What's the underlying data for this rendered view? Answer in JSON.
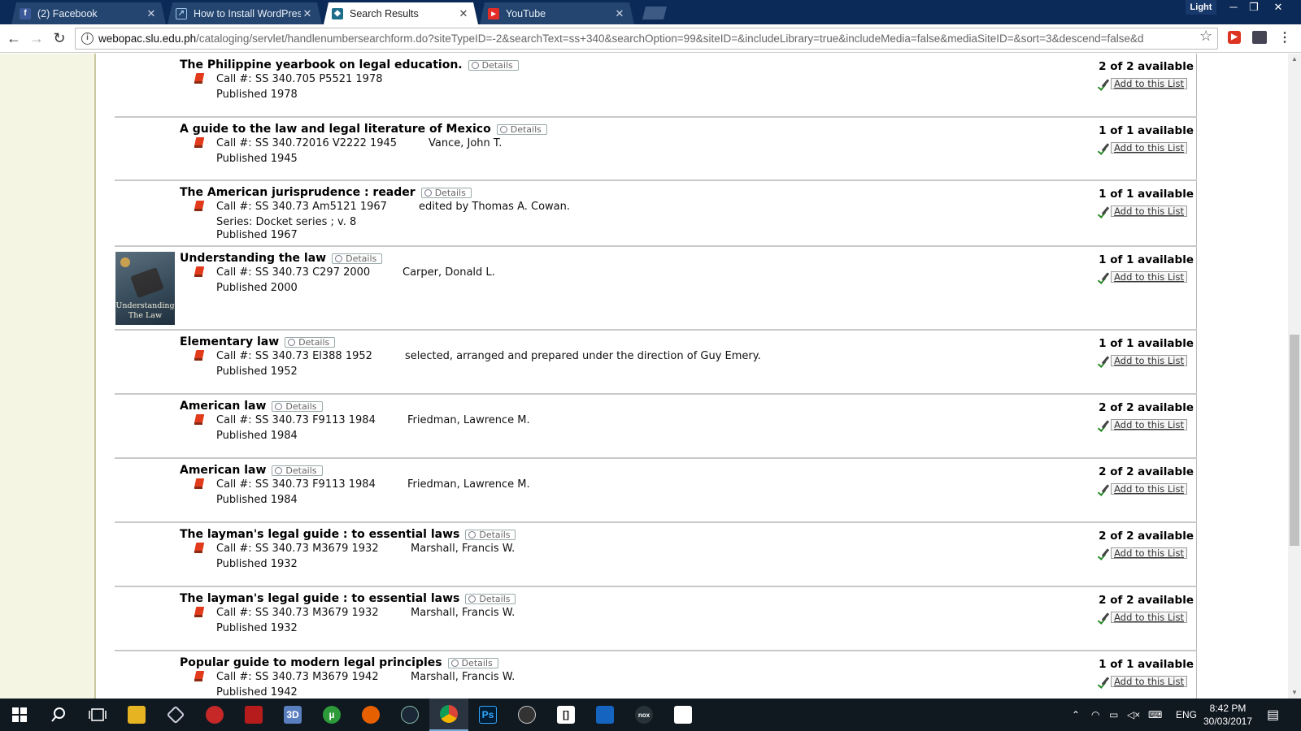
{
  "browser": {
    "tabs": [
      {
        "label": "(2) Facebook",
        "icon": "facebook-icon",
        "active": false
      },
      {
        "label": "How to Install WordPress",
        "icon": "wordpress-icon",
        "active": false
      },
      {
        "label": "Search Results",
        "icon": "site-icon",
        "active": true
      },
      {
        "label": "YouTube",
        "icon": "youtube-icon",
        "active": false
      }
    ],
    "profile_label": "Light",
    "url_host": "webopac.slu.edu.ph",
    "url_path": "/cataloging/servlet/handlenumbersearchform.do?siteTypeID=-2&searchText=ss+340&searchOption=99&siteID=&includeLibrary=true&includeMedia=false&mediaSiteID=&sort=3&descend=false&d"
  },
  "labels": {
    "details": "Details",
    "add_to_list": "Add to this List",
    "call_prefix": "Call #:",
    "published_prefix": "Published"
  },
  "records": [
    {
      "title": "The Philippine yearbook on legal education.",
      "call": "SS 340.705 P5521 1978",
      "author": "",
      "series": "",
      "published": "1978",
      "availability": "2 of 2 available"
    },
    {
      "title": "A guide to the law and legal literature of Mexico",
      "call": "SS 340.72016 V2222 1945",
      "author": "Vance, John T.",
      "series": "",
      "published": "1945",
      "availability": "1 of 1 available"
    },
    {
      "title": "The American jurisprudence : reader",
      "call": "SS 340.73 Am5121 1967",
      "author": "edited by Thomas A. Cowan.",
      "series": "Series: Docket series ; v. 8",
      "published": "1967",
      "availability": "1 of 1 available"
    },
    {
      "title": "Understanding the law",
      "call": "SS 340.73 C297 2000",
      "author": "Carper, Donald L.",
      "series": "",
      "published": "2000",
      "availability": "1 of 1 available",
      "thumb_line1": "Understanding",
      "thumb_line2": "The Law"
    },
    {
      "title": "Elementary law",
      "call": "SS 340.73 El388 1952",
      "author": "selected, arranged and prepared under the direction of Guy Emery.",
      "series": "",
      "published": "1952",
      "availability": "1 of 1 available"
    },
    {
      "title": "American law",
      "call": "SS 340.73 F9113 1984",
      "author": "Friedman, Lawrence M.",
      "series": "",
      "published": "1984",
      "availability": "2 of 2 available"
    },
    {
      "title": "American law",
      "call": "SS 340.73 F9113 1984",
      "author": "Friedman, Lawrence M.",
      "series": "",
      "published": "1984",
      "availability": "2 of 2 available"
    },
    {
      "title": "The layman's legal guide : to essential laws",
      "call": "SS 340.73 M3679 1932",
      "author": "Marshall, Francis W.",
      "series": "",
      "published": "1932",
      "availability": "2 of 2 available"
    },
    {
      "title": "The layman's legal guide : to essential laws",
      "call": "SS 340.73 M3679 1932",
      "author": "Marshall, Francis W.",
      "series": "",
      "published": "1932",
      "availability": "2 of 2 available"
    },
    {
      "title": "Popular guide to modern legal principles",
      "call": "SS 340.73 M3679 1942",
      "author": "Marshall, Francis W.",
      "series": "",
      "published": "1942",
      "availability": "1 of 1 available"
    }
  ],
  "taskbar": {
    "language": "ENG",
    "time": "8:42 PM",
    "date": "30/03/2017"
  }
}
